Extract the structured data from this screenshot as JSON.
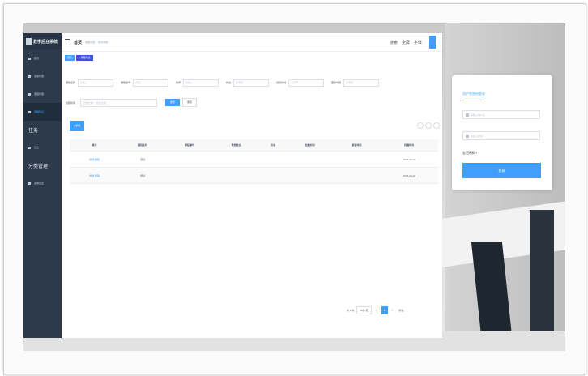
{
  "app": {
    "logo_text": "教学后台系统",
    "breadcrumb": [
      "首页",
      "课程管理",
      "新增课程"
    ],
    "current_crumb": "首页",
    "tags": [
      "首页",
      "● 课程列表"
    ],
    "top_icons": [
      "搜索",
      "全屏",
      "字体"
    ]
  },
  "sidebar": {
    "items": [
      "首页",
      "系统管理",
      "课程管理",
      "课程列表",
      "任务",
      "日志",
      "分类管理",
      "系统监控"
    ]
  },
  "filters": {
    "labels": [
      "课程名称",
      "课程编号",
      "教师",
      "状态",
      "创建时间",
      "更新时间"
    ],
    "placeholders": [
      "请输入",
      "请输入",
      "请输入",
      "请选择",
      "请选择",
      "请选择"
    ],
    "date_label": "创建时间",
    "date_start": "开始日期",
    "date_end": "结束日期",
    "search_label": "搜索",
    "reset_label": "重置"
  },
  "toolbar": {
    "add_label": "+ 新增"
  },
  "table": {
    "headers": [
      "操作",
      "课程名称",
      "课程编号",
      "教师姓名",
      "状态",
      "创建时间",
      "更新时间",
      "创建时间"
    ],
    "rows": [
      {
        "ops": "修改  删除",
        "name": "测试",
        "date": "2018-09-20"
      },
      {
        "ops": "修改  删除",
        "name": "测试",
        "date": "2018-09-20"
      }
    ]
  },
  "pager": {
    "total": "共 2 条",
    "size": "10条/页",
    "pages": [
      "<",
      "1",
      ">"
    ],
    "goto": "前往"
  },
  "login": {
    "tab": "用户名密码登录",
    "user_placeholder": "请输入用户名",
    "pass_placeholder": "请输入密码",
    "forgot": "忘记密码?",
    "button": "登录"
  }
}
